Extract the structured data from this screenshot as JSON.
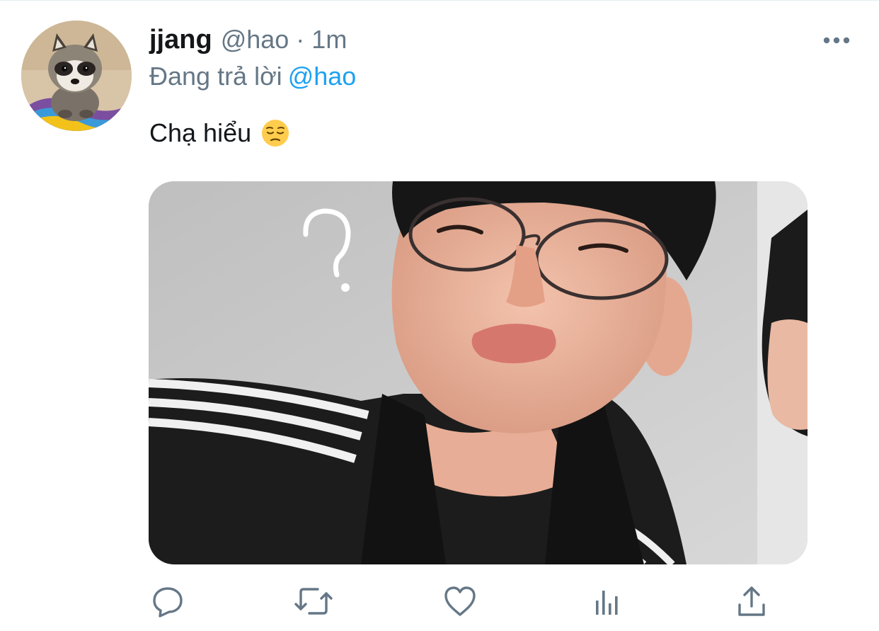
{
  "tweet": {
    "display_name": "jjang",
    "handle": "@hao",
    "separator": "·",
    "time": "1m",
    "replying_prefix": "Đang trả lời",
    "replying_to": "@hao",
    "text": "Chạ hiểu",
    "emoji": "pensive-face-emoji"
  },
  "icons": {
    "more": "more-horizontal-icon",
    "reply": "reply-icon",
    "retweet": "retweet-icon",
    "like": "like-icon",
    "analytics": "analytics-icon",
    "share": "share-icon"
  },
  "colors": {
    "link": "#1da1f2",
    "secondary_text": "#657786",
    "primary_text": "#14171a"
  }
}
